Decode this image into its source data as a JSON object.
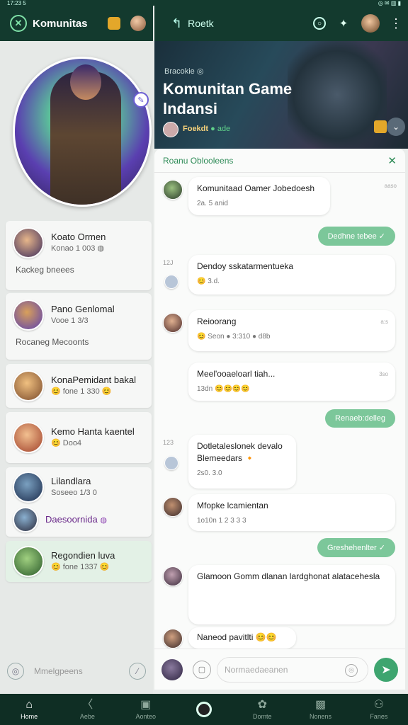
{
  "status": {
    "time": "17:23 5",
    "icons": "◎ ✉ ▥ ▮"
  },
  "left": {
    "brand": "Komunitas",
    "brand_icon": "✕",
    "contacts": [
      {
        "name": "Koato Ormen",
        "sub": "Konao 1 003 ◍"
      },
      {
        "name": "Pano Genlomal",
        "sub": "Vooe 1 3/3"
      },
      {
        "name": "KonaPemidant bakal",
        "sub": "😊 fone 1 330 😊"
      },
      {
        "name": "Kemo Hanta kaentel",
        "sub": "😊 Doo4"
      },
      {
        "name": "Lilandlara",
        "sub": "Soseeo 1/3 0"
      },
      {
        "name": "Daesoornida",
        "sub": "◍"
      },
      {
        "name": "Regondien luva",
        "sub": "😊 fone 1337 😊"
      }
    ],
    "sections": [
      "Kackeg bneees",
      "Rocaneg Mecoonts"
    ],
    "input_placeholder": "Mmelgpeens"
  },
  "right": {
    "title": "Roetk",
    "banner": {
      "small": "Bracokie ◎",
      "title": "Komunitan Game lndansi",
      "meta_name": "Foekdt",
      "meta_status": "● ade"
    },
    "chat_title": "Roanu Oblooleens",
    "messages": [
      {
        "text": "Komunitaad Oamer Jobedoesh",
        "sub": "2a. 5 anid",
        "time": "aaso"
      },
      {
        "sent": "Dedhne tebee ✓"
      },
      {
        "side_time": "12J",
        "text": "Dendoy sskatarmentueka",
        "sub": "😊 3.d.",
        "time": ""
      },
      {
        "text": "Reioorang",
        "sub": "😊 Seon ● 3:310 ● d8b",
        "time": "a:s"
      },
      {
        "text": "Meel'ooaeloarl tiah...",
        "sub": "13dn 😊😊😊😊",
        "time": "3so"
      },
      {
        "sent": "Renaeb:delleg"
      },
      {
        "side_time": "123",
        "text": "Dotletaleslonek devalo Blemeedars 🔸",
        "sub": "2s0. 3.0",
        "time": ""
      },
      {
        "text": "Mfopke lcamientan",
        "sub": "1o10n 1 2 3 3 3",
        "time": ""
      },
      {
        "sent": "Greshehenlter ✓"
      },
      {
        "text": "Glamoon Gomm dlanan lardghonat alatacehesla",
        "sub": "",
        "time": ""
      },
      {
        "text": "Naneod pavitlti 😊😊",
        "sub": "",
        "time": ""
      }
    ],
    "composer_placeholder": "Normaedaeanen"
  },
  "nav": [
    {
      "label": "Home",
      "icon": "⌂"
    },
    {
      "label": "Aebe",
      "icon": "〈"
    },
    {
      "label": "Aonteo",
      "icon": "▣"
    },
    {
      "label": "",
      "icon": ""
    },
    {
      "label": "Domte",
      "icon": "✿"
    },
    {
      "label": "Nonens",
      "icon": "▩"
    },
    {
      "label": "Fanes",
      "icon": "⚇"
    }
  ]
}
